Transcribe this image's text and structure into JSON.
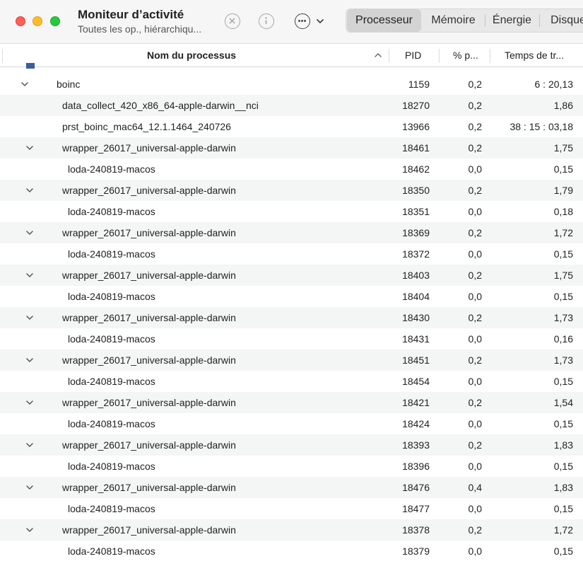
{
  "window": {
    "title": "Moniteur d’activité",
    "subtitle": "Toutes les op., hiérarchiqu..."
  },
  "tabs": [
    {
      "label": "Processeur",
      "active": true
    },
    {
      "label": "Mémoire",
      "active": false
    },
    {
      "label": "Énergie",
      "active": false
    },
    {
      "label": "Disque",
      "active": false
    }
  ],
  "columns": {
    "name": "Nom du processus",
    "pid": "PID",
    "cpu": "% p...",
    "time": "Temps de tr..."
  },
  "rows": [
    {
      "name": "boinc",
      "pid": "1159",
      "cpu": "0,2",
      "time": "6 : 20,13",
      "level": 0,
      "expandable": true
    },
    {
      "name": "data_collect_420_x86_64-apple-darwin__nci",
      "pid": "18270",
      "cpu": "0,2",
      "time": "1,86",
      "level": 1,
      "expandable": false
    },
    {
      "name": "prst_boinc_mac64_12.1.1464_240726",
      "pid": "13966",
      "cpu": "0,2",
      "time": "38 : 15 : 03,18",
      "level": 1,
      "expandable": false
    },
    {
      "name": "wrapper_26017_universal-apple-darwin",
      "pid": "18461",
      "cpu": "0,2",
      "time": "1,75",
      "level": 1,
      "expandable": true
    },
    {
      "name": "loda-240819-macos",
      "pid": "18462",
      "cpu": "0,0",
      "time": "0,15",
      "level": 2,
      "expandable": false
    },
    {
      "name": "wrapper_26017_universal-apple-darwin",
      "pid": "18350",
      "cpu": "0,2",
      "time": "1,79",
      "level": 1,
      "expandable": true
    },
    {
      "name": "loda-240819-macos",
      "pid": "18351",
      "cpu": "0,0",
      "time": "0,18",
      "level": 2,
      "expandable": false
    },
    {
      "name": "wrapper_26017_universal-apple-darwin",
      "pid": "18369",
      "cpu": "0,2",
      "time": "1,72",
      "level": 1,
      "expandable": true
    },
    {
      "name": "loda-240819-macos",
      "pid": "18372",
      "cpu": "0,0",
      "time": "0,15",
      "level": 2,
      "expandable": false
    },
    {
      "name": "wrapper_26017_universal-apple-darwin",
      "pid": "18403",
      "cpu": "0,2",
      "time": "1,75",
      "level": 1,
      "expandable": true
    },
    {
      "name": "loda-240819-macos",
      "pid": "18404",
      "cpu": "0,0",
      "time": "0,15",
      "level": 2,
      "expandable": false
    },
    {
      "name": "wrapper_26017_universal-apple-darwin",
      "pid": "18430",
      "cpu": "0,2",
      "time": "1,73",
      "level": 1,
      "expandable": true
    },
    {
      "name": "loda-240819-macos",
      "pid": "18431",
      "cpu": "0,0",
      "time": "0,16",
      "level": 2,
      "expandable": false
    },
    {
      "name": "wrapper_26017_universal-apple-darwin",
      "pid": "18451",
      "cpu": "0,2",
      "time": "1,73",
      "level": 1,
      "expandable": true
    },
    {
      "name": "loda-240819-macos",
      "pid": "18454",
      "cpu": "0,0",
      "time": "0,15",
      "level": 2,
      "expandable": false
    },
    {
      "name": "wrapper_26017_universal-apple-darwin",
      "pid": "18421",
      "cpu": "0,2",
      "time": "1,54",
      "level": 1,
      "expandable": true
    },
    {
      "name": "loda-240819-macos",
      "pid": "18424",
      "cpu": "0,0",
      "time": "0,15",
      "level": 2,
      "expandable": false
    },
    {
      "name": "wrapper_26017_universal-apple-darwin",
      "pid": "18393",
      "cpu": "0,2",
      "time": "1,83",
      "level": 1,
      "expandable": true
    },
    {
      "name": "loda-240819-macos",
      "pid": "18396",
      "cpu": "0,0",
      "time": "0,15",
      "level": 2,
      "expandable": false
    },
    {
      "name": "wrapper_26017_universal-apple-darwin",
      "pid": "18476",
      "cpu": "0,4",
      "time": "1,83",
      "level": 1,
      "expandable": true
    },
    {
      "name": "loda-240819-macos",
      "pid": "18477",
      "cpu": "0,0",
      "time": "0,15",
      "level": 2,
      "expandable": false
    },
    {
      "name": "wrapper_26017_universal-apple-darwin",
      "pid": "18378",
      "cpu": "0,2",
      "time": "1,72",
      "level": 1,
      "expandable": true
    },
    {
      "name": "loda-240819-macos",
      "pid": "18379",
      "cpu": "0,0",
      "time": "0,15",
      "level": 2,
      "expandable": false
    }
  ],
  "colors": {
    "close": "#ff5f57",
    "minimize": "#febc2e",
    "zoom": "#28c840",
    "row_alt": "#f4f5f5"
  }
}
